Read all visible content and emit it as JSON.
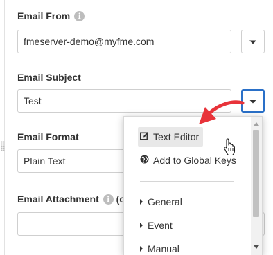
{
  "fields": {
    "email_from": {
      "label": "Email From",
      "value": "fmeserver-demo@myfme.com"
    },
    "email_subject": {
      "label": "Email Subject",
      "value": "Test"
    },
    "email_format": {
      "label": "Email Format",
      "value": "Plain Text"
    },
    "email_attachment": {
      "label": "Email Attachment",
      "label_suffix": "(o",
      "value": ""
    }
  },
  "info_icon_glyph": "i",
  "menu": {
    "items": [
      {
        "label": "Text Editor",
        "icon": "edit-icon"
      },
      {
        "label": "Add to Global Keys",
        "icon": "globe-icon"
      }
    ],
    "groups": [
      {
        "label": "General"
      },
      {
        "label": "Event"
      },
      {
        "label": "Manual"
      }
    ]
  },
  "colors": {
    "active_border": "#2a70c8",
    "annotation_arrow": "#e8333a",
    "menu_hover": "#e8e8e8"
  }
}
